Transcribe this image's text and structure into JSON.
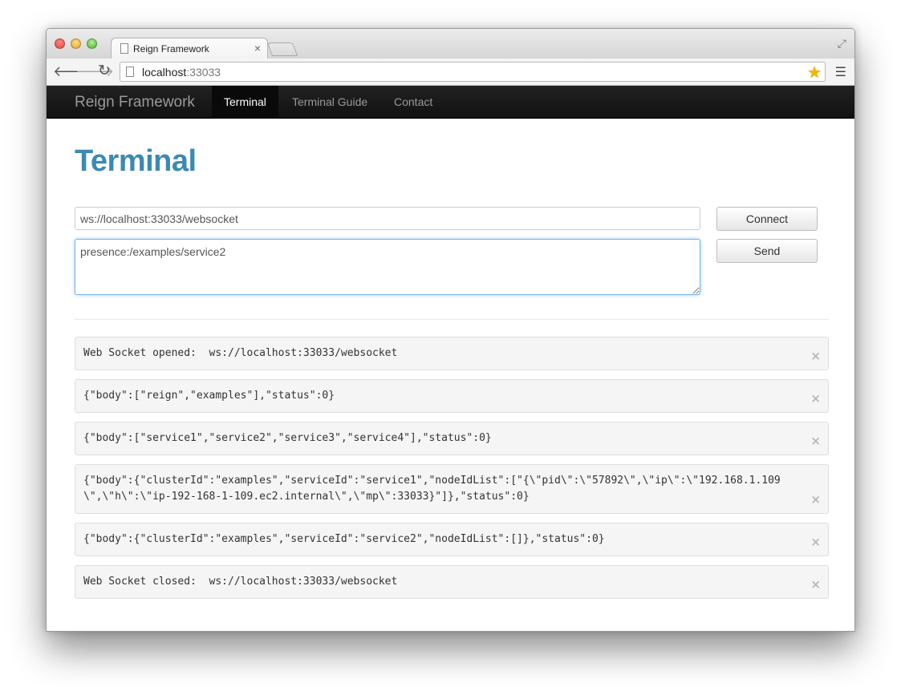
{
  "browser": {
    "tab_title": "Reign Framework",
    "tab_close": "×",
    "url_host": "localhost",
    "url_port": ":33033"
  },
  "navbar": {
    "brand": "Reign Framework",
    "items": [
      {
        "label": "Terminal",
        "active": true
      },
      {
        "label": "Terminal Guide",
        "active": false
      },
      {
        "label": "Contact",
        "active": false
      }
    ]
  },
  "page": {
    "title": "Terminal",
    "ws_url_value": "ws://localhost:33033/websocket",
    "message_value": "presence:/examples/service2",
    "connect_label": "Connect",
    "send_label": "Send"
  },
  "log": [
    "Web Socket opened:  ws://localhost:33033/websocket",
    "{\"body\":[\"reign\",\"examples\"],\"status\":0}",
    "{\"body\":[\"service1\",\"service2\",\"service3\",\"service4\"],\"status\":0}",
    "{\"body\":{\"clusterId\":\"examples\",\"serviceId\":\"service1\",\"nodeIdList\":[\"{\\\"pid\\\":\\\"57892\\\",\\\"ip\\\":\\\"192.168.1.109\\\",\\\"h\\\":\\\"ip-192-168-1-109.ec2.internal\\\",\\\"mp\\\":33033}\"]},\"status\":0}",
    "{\"body\":{\"clusterId\":\"examples\",\"serviceId\":\"service2\",\"nodeIdList\":[]},\"status\":0}",
    "Web Socket closed:  ws://localhost:33033/websocket"
  ],
  "colors": {
    "title_blue": "#3b8ab2",
    "navbar_bg": "#1b1b1b",
    "focus_border": "#7ab2e0"
  }
}
